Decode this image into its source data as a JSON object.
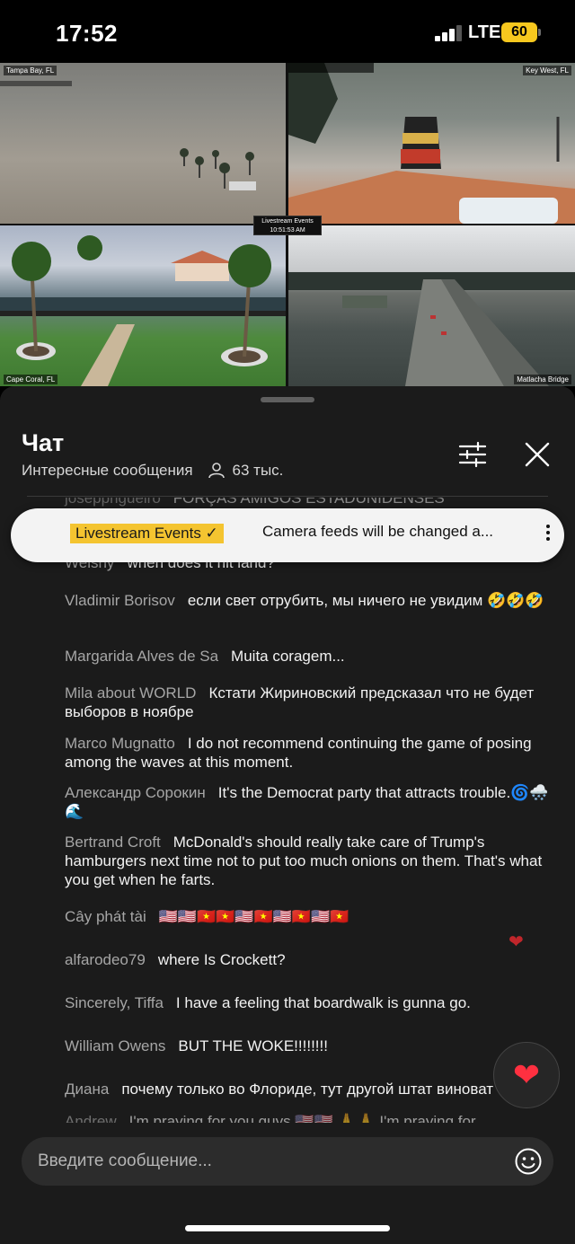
{
  "status_bar": {
    "time": "17:52",
    "network": "LTE",
    "battery": "60"
  },
  "video": {
    "cam1_label": "Tampa Bay, FL",
    "cam2_label": "Key West, FL",
    "cam3_label": "Cape Coral, FL",
    "cam4_label": "Matlacha Bridge",
    "overlay_title": "Livestream Events",
    "overlay_time": "10:51:53 AM"
  },
  "chat": {
    "title": "Чат",
    "filter_label": "Интересные сообщения",
    "viewers": "63 тыс.",
    "pinned_badge": "Livestream Events ✓",
    "pinned_text": "Camera feeds will be changed a...",
    "messages": [
      {
        "author": "josepprigueiro",
        "text": "FORÇAS AMIGOS ESTADUNIDENSES"
      },
      {
        "author": "Welshy",
        "text": "when does it hit land?"
      },
      {
        "author": "Vladimir Borisov",
        "text": "если свет отрубить, мы ничего не увидим 🤣🤣🤣"
      },
      {
        "author": "Margarida Alves de Sa",
        "text": "Muita coragem..."
      },
      {
        "author": "Mila about WORLD",
        "text": "Кстати Жириновский предсказал что не будет выборов в ноябре"
      },
      {
        "author": "Marco Mugnatto",
        "text": "I do not recommend continuing the game of posing among the waves at this moment."
      },
      {
        "author": "Александр Сорокин",
        "text": "It's the Democrat party that attracts trouble.🌀🌨️🌊"
      },
      {
        "author": "Bertrand Croft",
        "text": "McDonald's should really take care of Trump's hamburgers next time not to put too much onions on them. That's what you get when he farts."
      },
      {
        "author": "Cây phát tài",
        "text": "🇺🇸🇺🇸🇻🇳🇻🇳🇺🇸🇻🇳🇺🇸🇻🇳🇺🇸🇻🇳"
      },
      {
        "author": "alfarodeo79",
        "text": "where Is Crockett?"
      },
      {
        "author": "Sincerely, Tiffa",
        "text": "I have a feeling that boardwalk is gunna go."
      },
      {
        "author": "William Owens",
        "text": "BUT THE WOKE!!!!!!!!"
      },
      {
        "author": "Диана",
        "text": "почему только во Флориде, тут другой штат виноват"
      },
      {
        "author": "Andrew",
        "text": "I'm praying for you guys 🇺🇸🇺🇸 🙏🙏 I'm praying for"
      }
    ],
    "input_placeholder": "Введите сообщение..."
  },
  "colors": {
    "sheet_bg": "#1b1b1b",
    "pinned_badge": "#f4c430",
    "battery": "#f7c81e",
    "heart": "#ff3040"
  }
}
